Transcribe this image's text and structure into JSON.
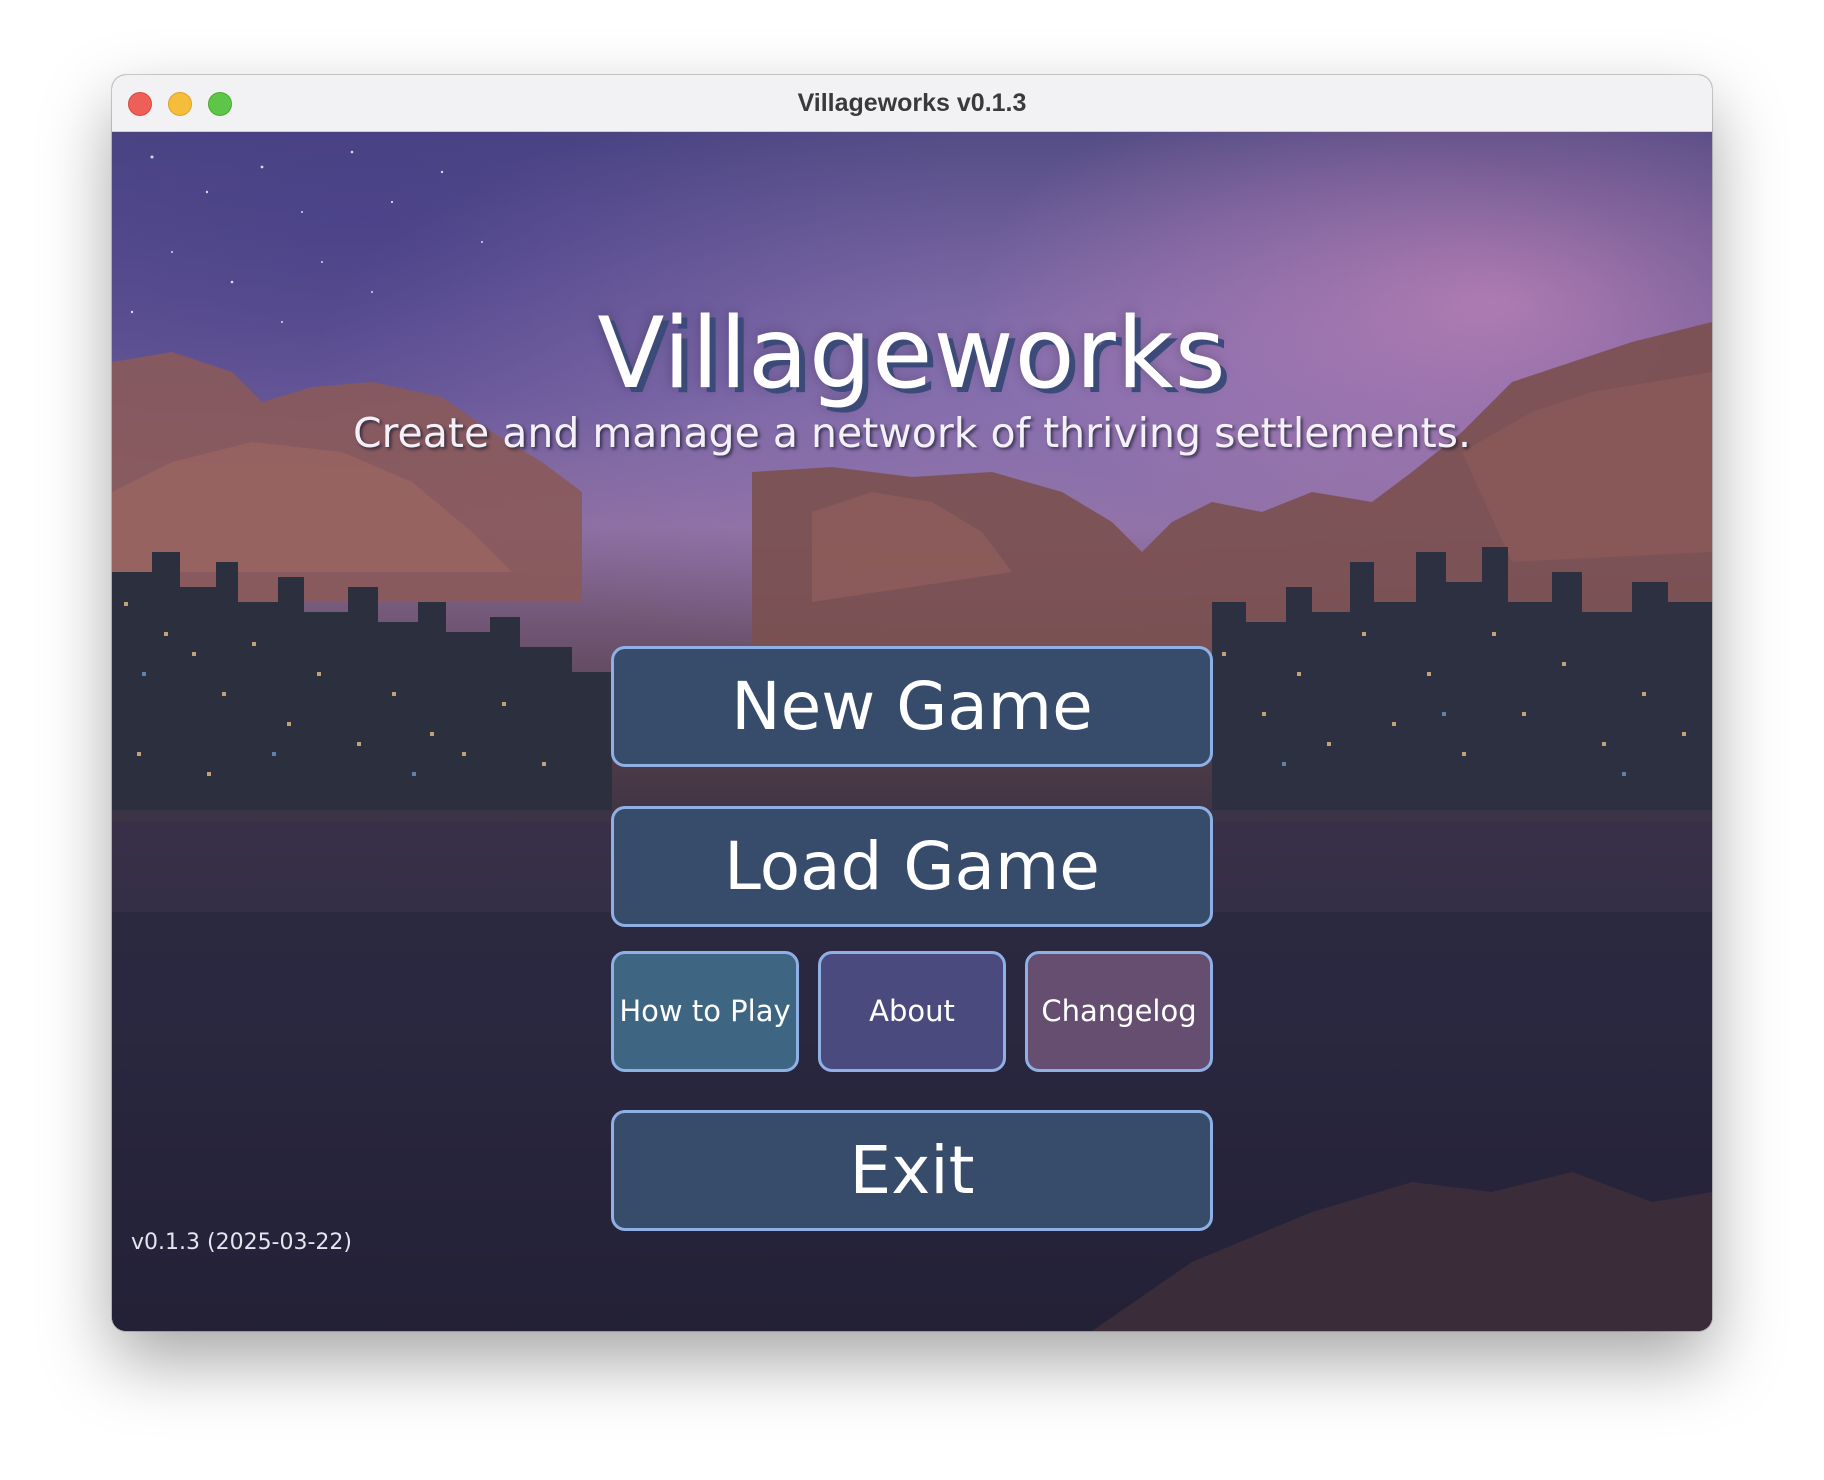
{
  "window": {
    "title": "Villageworks v0.1.3"
  },
  "hero": {
    "title": "Villageworks",
    "subtitle": "Create and manage a network of thriving settlements."
  },
  "menu": {
    "new_game": "New Game",
    "load_game": "Load Game",
    "how_to_play": "How to Play",
    "about": "About",
    "changelog": "Changelog",
    "exit": "Exit"
  },
  "footer": {
    "version": "v0.1.3 (2025-03-22)"
  },
  "colors": {
    "button_primary": "#374c6b",
    "button_how_to_play": "#3e6682",
    "button_about": "#4b4a7f",
    "button_changelog": "#654e6f",
    "button_border": "#8fb0e4"
  }
}
